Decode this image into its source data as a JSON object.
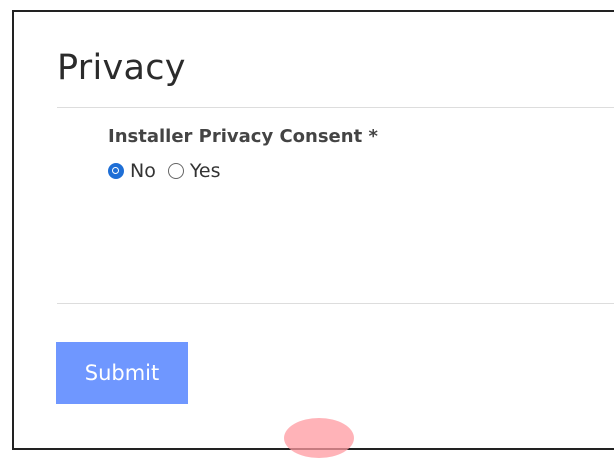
{
  "form": {
    "section_title": "Privacy",
    "field_label": "Installer Privacy Consent *",
    "options": [
      {
        "label": "No",
        "checked": true
      },
      {
        "label": "Yes",
        "checked": false
      }
    ],
    "submit_label": "Submit"
  },
  "colors": {
    "accent": "#1f6fd6",
    "button_bg": "#6f97ff"
  }
}
